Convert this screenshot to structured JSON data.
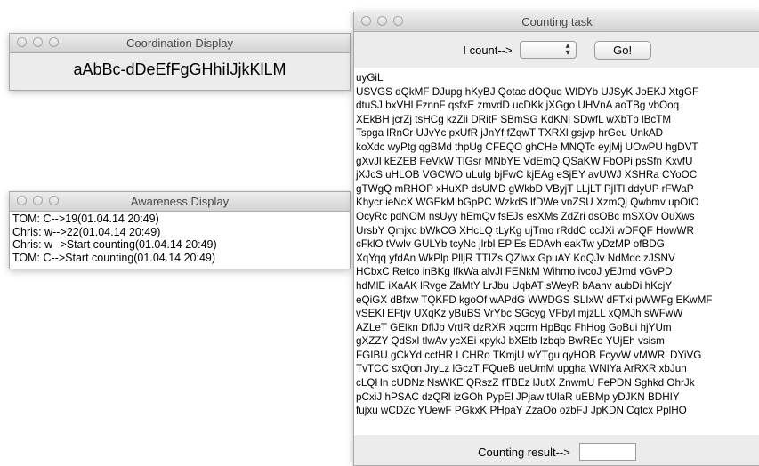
{
  "coordination": {
    "title": "Coordination Display",
    "sequence": "aAbBc-dDeEfFgGHhiIJjkKlLM"
  },
  "awareness": {
    "title": "Awareness Display",
    "entries": [
      "TOM: C-->19(01.04.14 20:49)",
      "Chris: w-->22(01.04.14 20:49)",
      "Chris: w-->Start counting(01.04.14 20:49)",
      "TOM: C-->Start counting(01.04.14 20:49)"
    ]
  },
  "counting": {
    "title": "Counting task",
    "count_label": "I count-->",
    "select_value": "",
    "go_label": "Go!",
    "result_label": "Counting result-->",
    "result_value": "",
    "lines": [
      "uyGiL",
      "USVGS dQkMF DJupg hKyBJ Qotac dOQuq WIDYb UJSyK JoEKJ XtgGF",
      "dtuSJ bxVHl FznnF qsfxE zmvdD ucDKk jXGgo UHVnA aoTBg vbOoq",
      "XEkBH jcrZj tsHCg kzZii DRitF SBmSG KdKNl SDwfL wXbTp lBcTM",
      "Tspga lRnCr UJvYc pxUfR jJnYf fZqwT TXRXl gsjvp hrGeu UnkAD",
      "koXdc wyPtg qgBMd thpUg CFEQO ghCHe MNQTc eyjMj UOwPU hgDVT",
      "gXvJl kEZEB FeVkW TlGsr MNbYE VdEmQ QSaKW FbOPi psSfn KxvfU",
      "jXJcS uHLOB VGCWO uLulg bjFwC kjEAg eSjEY avUWJ XSHRa CYoOC",
      "gTWgQ mRHOP xHuXP dsUMD gWkbD VByjT LLjLT PjITl ddyUP rFWaP",
      "Khycr ieNcX WGEkM bGpPC WzkdS lfDWe vnZSU XzmQj Qwbmv upOtO",
      "OcyRc pdNOM nsUyy hEmQv fsEJs esXMs ZdZri dsOBc mSXOv OuXws",
      "UrsbY Qmjxc bWkCG XHcLQ tLyKg ujTmo rRddC ccJXi wDFQF HowWR",
      "cFklO tVwlv GULYb tcyNc jlrbl EPiEs EDAvh eakTw yDzMP ofBDG",
      "XqYqq yfdAn WkPlp PlljR TTIZs QZlwx GpuAY KdQJv NdMdc zJSNV",
      "HCbxC Retco inBKg lfkWa alvJl FENkM Wihmo ivcoJ yEJmd vGvPD",
      "hdMlE iXaAK lRvge ZaMtY LrJbu UqbAT sWeyR bAahv aubDi hKcjY",
      "eQiGX dBfxw TQKFD kgoOf wAPdG WWDGS SLIxW dFTxi pWWFg EKwMF",
      "vSEKl EFtjv UXqKz yBuBS VrYbc SGcyg VFbyl mjzLL xQMJh sWFwW",
      "AZLeT GElkn DflJb VrtlR dzRXR xqcrm HpBqc FhHog GoBui hjYUm",
      "gXZZY QdSxl tlwAv ycXEi xpykJ bXEtb Izbqb BwREo YUjEh vsism",
      "FGIBU gCkYd cctHR LCHRo TKmjU wYTgu qyHOB FcyvW vMWRl DYiVG",
      "TvTCC sxQon JryLz lGczT FQueB ueUmM upgha WNIYa ArRXR xbJun",
      "cLQHn cUDNz NsWKE QRszZ fTBEz lJutX ZnwmU FePDN Sghkd OhrJk",
      "pCxiJ hPSAC dzQRl izGOh PypEl JPjaw tUlaR uEBMp yDJKN BDHIY",
      "fujxu wCDZc YUewF PGkxK PHpaY ZzaOo ozbFJ JpKDN Cqtcx PplHO"
    ]
  }
}
